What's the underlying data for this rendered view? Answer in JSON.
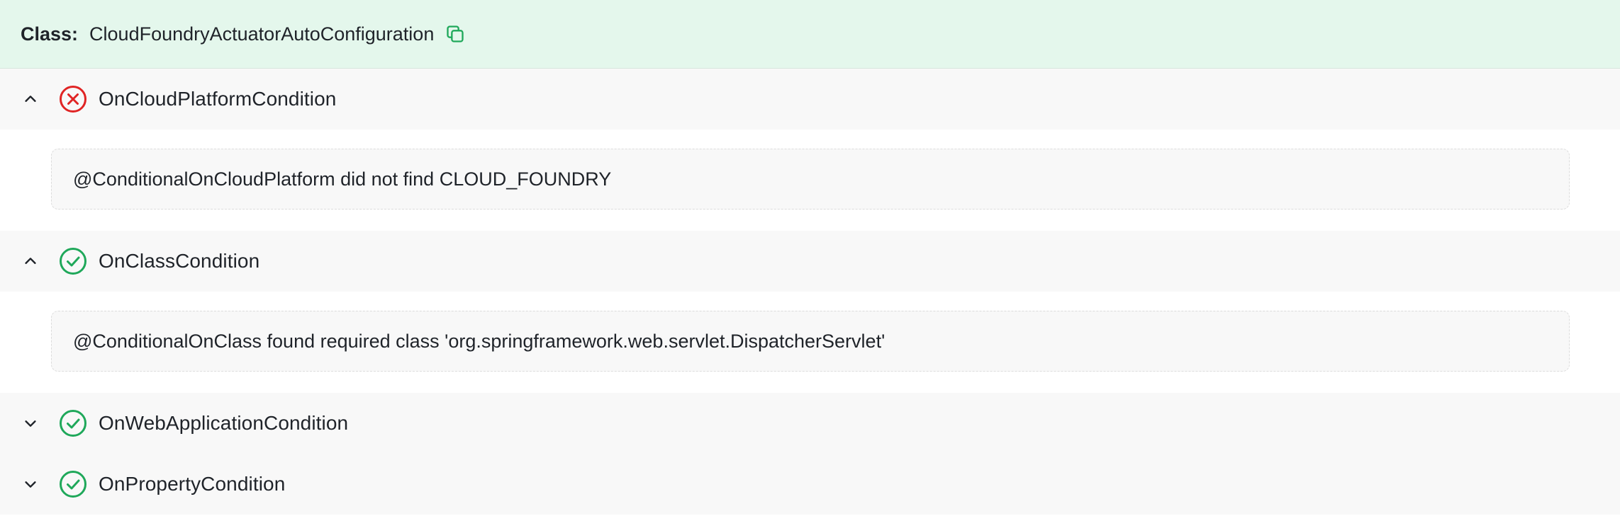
{
  "header": {
    "label": "Class:",
    "class_name": "CloudFoundryActuatorAutoConfiguration",
    "copy_icon": "copy-icon"
  },
  "conditions": [
    {
      "name": "OnCloudPlatformCondition",
      "status": "failed",
      "expanded": true,
      "message": "@ConditionalOnCloudPlatform did not find CLOUD_FOUNDRY"
    },
    {
      "name": "OnClassCondition",
      "status": "passed",
      "expanded": true,
      "message": "@ConditionalOnClass found required class 'org.springframework.web.servlet.DispatcherServlet'"
    },
    {
      "name": "OnWebApplicationCondition",
      "status": "passed",
      "expanded": false
    },
    {
      "name": "OnPropertyCondition",
      "status": "passed",
      "expanded": false
    }
  ],
  "colors": {
    "header_bg": "#e4f7ec",
    "success": "#1fa85a",
    "failure": "#e02424",
    "copy_icon": "#1fa85a",
    "row_bg": "#f8f8f8"
  }
}
